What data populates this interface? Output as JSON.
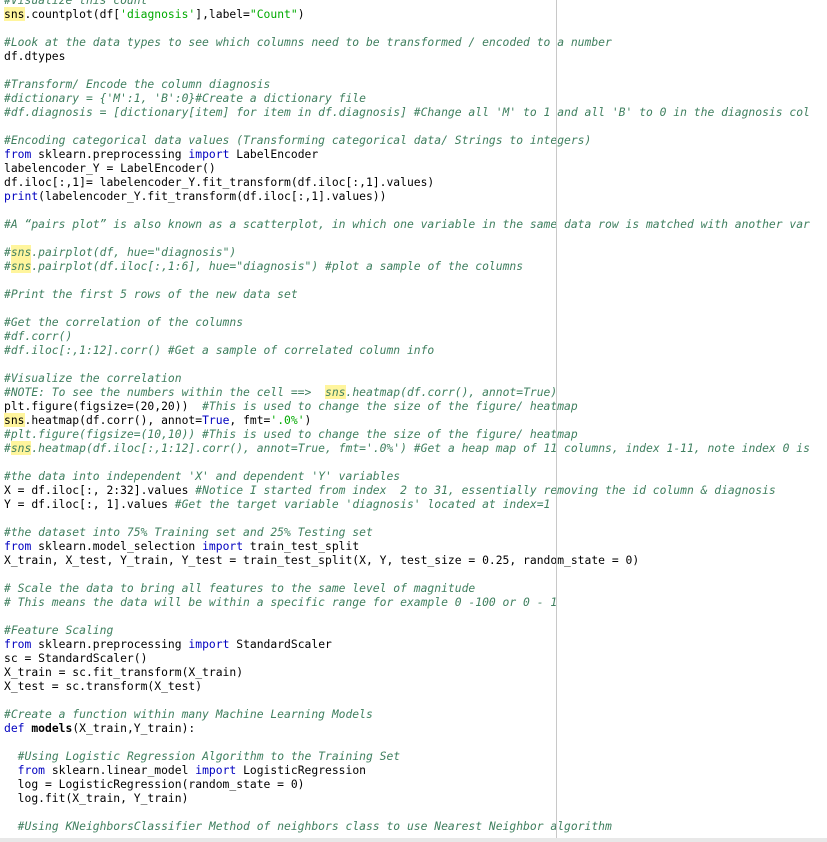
{
  "editor": {
    "lines": [
      [
        {
          "t": "#Visualize this count",
          "c": "cm"
        }
      ],
      [
        {
          "t": "sns",
          "c": "hl"
        },
        {
          "t": ".countplot(df["
        },
        {
          "t": "'diagnosis'",
          "c": "str"
        },
        {
          "t": "],label="
        },
        {
          "t": "\"Count\"",
          "c": "str"
        },
        {
          "t": ")"
        }
      ],
      [],
      [
        {
          "t": "#Look at the data types to see which columns need to be transformed / encoded to a number",
          "c": "cm"
        }
      ],
      [
        {
          "t": "df.dtypes"
        }
      ],
      [],
      [
        {
          "t": "#Transform/ Encode the column diagnosis",
          "c": "cm"
        }
      ],
      [
        {
          "t": "#dictionary = {'M':1, 'B':0}#Create a dictionary file",
          "c": "cm"
        }
      ],
      [
        {
          "t": "#df.diagnosis = [dictionary[item] for item in df.diagnosis] #Change all 'M' to 1 and all 'B' to 0 in the diagnosis col",
          "c": "cm"
        }
      ],
      [],
      [
        {
          "t": "#Encoding categorical data values (Transforming categorical data/ Strings to integers)",
          "c": "cm"
        }
      ],
      [
        {
          "t": "from",
          "c": "kw"
        },
        {
          "t": " sklearn.preprocessing "
        },
        {
          "t": "import",
          "c": "kw"
        },
        {
          "t": " LabelEncoder"
        }
      ],
      [
        {
          "t": "labelencoder_Y = LabelEncoder()"
        }
      ],
      [
        {
          "t": "df.iloc[:,1]= labelencoder_Y.fit_transform(df.iloc[:,1].values)"
        }
      ],
      [
        {
          "t": "print",
          "c": "kw"
        },
        {
          "t": "(labelencoder_Y.fit_transform(df.iloc[:,1].values))"
        }
      ],
      [],
      [
        {
          "t": "#A “pairs plot” is also known as a scatterplot, in which one variable in the same data row is matched with another var",
          "c": "cm"
        }
      ],
      [],
      [
        {
          "t": "#",
          "c": "cm"
        },
        {
          "t": "sns",
          "c": "cm hl"
        },
        {
          "t": ".pairplot(df, hue=\"diagnosis\")",
          "c": "cm"
        }
      ],
      [
        {
          "t": "#",
          "c": "cm"
        },
        {
          "t": "sns",
          "c": "cm hl"
        },
        {
          "t": ".pairplot(df.iloc[:,1:6], hue=\"diagnosis\") #plot a sample of the columns",
          "c": "cm"
        }
      ],
      [],
      [
        {
          "t": "#Print the first 5 rows of the new data set",
          "c": "cm"
        }
      ],
      [],
      [
        {
          "t": "#Get the correlation of the columns",
          "c": "cm"
        }
      ],
      [
        {
          "t": "#df.corr()",
          "c": "cm"
        }
      ],
      [
        {
          "t": "#df.iloc[:,1:12].corr() #Get a sample of correlated column info",
          "c": "cm"
        }
      ],
      [],
      [
        {
          "t": "#Visualize the correlation",
          "c": "cm"
        }
      ],
      [
        {
          "t": "#NOTE: To see the numbers within the cell ==>  ",
          "c": "cm"
        },
        {
          "t": "sns",
          "c": "cm hl"
        },
        {
          "t": ".heatmap(df.corr(), annot=True)",
          "c": "cm"
        }
      ],
      [
        {
          "t": "plt.figure(figsize=(20,20))  "
        },
        {
          "t": "#This is used to change the size of the figure/ heatmap",
          "c": "cm"
        }
      ],
      [
        {
          "t": "sns",
          "c": "hl"
        },
        {
          "t": ".heatmap(df.corr(), annot="
        },
        {
          "t": "True",
          "c": "kw"
        },
        {
          "t": ", fmt="
        },
        {
          "t": "'.0%'",
          "c": "str"
        },
        {
          "t": ")"
        }
      ],
      [
        {
          "t": "#plt.figure(figsize=(10,10)) #This is used to change the size of the figure/ heatmap",
          "c": "cm"
        }
      ],
      [
        {
          "t": "#",
          "c": "cm"
        },
        {
          "t": "sns",
          "c": "cm hl"
        },
        {
          "t": ".heatmap(df.iloc[:,1:12].corr(), annot=True, fmt='.0%') #Get a heap map of 11 columns, index 1-11, note index 0 is",
          "c": "cm"
        }
      ],
      [],
      [
        {
          "t": "#the data into independent 'X' and dependent 'Y' variables",
          "c": "cm"
        }
      ],
      [
        {
          "t": "X = df.iloc[:, 2:32].values "
        },
        {
          "t": "#Notice I started from index  2 to 31, essentially removing the id column & diagnosis",
          "c": "cm"
        }
      ],
      [
        {
          "t": "Y = df.iloc[:, 1].values "
        },
        {
          "t": "#Get the target variable 'diagnosis' located at index=1",
          "c": "cm"
        }
      ],
      [],
      [
        {
          "t": "#the dataset into 75% Training set and 25% Testing set",
          "c": "cm"
        }
      ],
      [
        {
          "t": "from",
          "c": "kw"
        },
        {
          "t": " sklearn.model_selection "
        },
        {
          "t": "import",
          "c": "kw"
        },
        {
          "t": " train_test_split"
        }
      ],
      [
        {
          "t": "X_train, X_test, Y_train, Y_test = train_test_split(X, Y, test_size = 0.25, random_state = 0)"
        }
      ],
      [],
      [
        {
          "t": "# Scale the data to bring all features to the same level of magnitude",
          "c": "cm"
        }
      ],
      [
        {
          "t": "# This means the data will be within a specific range for example 0 -100 or 0 - 1",
          "c": "cm"
        }
      ],
      [],
      [
        {
          "t": "#Feature Scaling",
          "c": "cm"
        }
      ],
      [
        {
          "t": "from",
          "c": "kw"
        },
        {
          "t": " sklearn.preprocessing "
        },
        {
          "t": "import",
          "c": "kw"
        },
        {
          "t": " StandardScaler"
        }
      ],
      [
        {
          "t": "sc = StandardScaler()"
        }
      ],
      [
        {
          "t": "X_train = sc.fit_transform(X_train)"
        }
      ],
      [
        {
          "t": "X_test = sc.transform(X_test)"
        }
      ],
      [],
      [
        {
          "t": "#Create a function within many Machine Learning Models",
          "c": "cm"
        }
      ],
      [
        {
          "t": "def",
          "c": "kw"
        },
        {
          "t": " "
        },
        {
          "t": "models",
          "c": "kw-bold"
        },
        {
          "t": "(X_train,Y_train):"
        }
      ],
      [],
      [
        {
          "t": "  "
        },
        {
          "t": "#Using Logistic Regression Algorithm to the Training Set",
          "c": "cm"
        }
      ],
      [
        {
          "t": "  "
        },
        {
          "t": "from",
          "c": "kw"
        },
        {
          "t": " sklearn.linear_model "
        },
        {
          "t": "import",
          "c": "kw"
        },
        {
          "t": " LogisticRegression"
        }
      ],
      [
        {
          "t": "  log = LogisticRegression(random_state = 0)"
        }
      ],
      [
        {
          "t": "  log.fit(X_train, Y_train)"
        }
      ],
      [],
      [
        {
          "t": "  "
        },
        {
          "t": "#Using KNeighborsClassifier Method of neighbors class to use Nearest Neighbor algorithm",
          "c": "cm"
        }
      ]
    ]
  }
}
